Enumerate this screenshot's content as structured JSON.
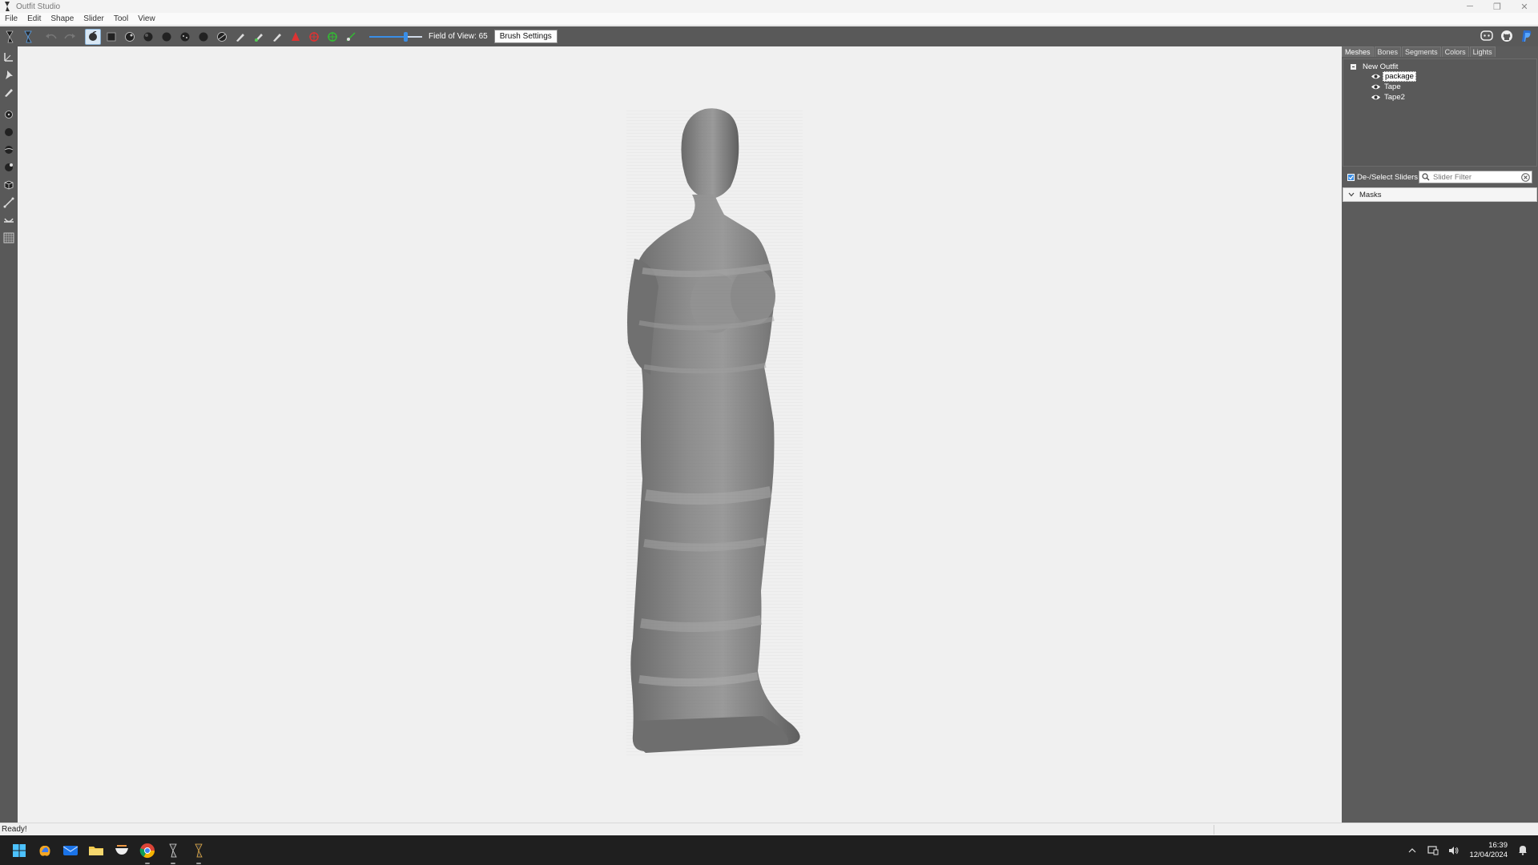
{
  "window": {
    "title": "Outfit Studio",
    "controls": {
      "minimize": "─",
      "restore": "❐",
      "close": "✕"
    }
  },
  "menu": {
    "items": [
      "File",
      "Edit",
      "Shape",
      "Slider",
      "Tool",
      "View"
    ]
  },
  "toolbar": {
    "fov_label": "Field of View: 65",
    "fov_value": 65,
    "brush_settings_label": "Brush Settings"
  },
  "panel": {
    "tabs": [
      "Meshes",
      "Bones",
      "Segments",
      "Colors",
      "Lights"
    ],
    "active_tab": "Meshes",
    "tree": {
      "root": "New Outfit",
      "children": [
        {
          "label": "package",
          "selected": true
        },
        {
          "label": "Tape",
          "selected": false
        },
        {
          "label": "Tape2",
          "selected": false
        }
      ]
    },
    "deselect_sliders_label": "De-/Select Sliders",
    "slider_filter_placeholder": "Slider Filter",
    "masks_label": "Masks"
  },
  "status": {
    "text": "Ready!"
  },
  "taskbar": {
    "time": "16:39",
    "date": "12/04/2024"
  },
  "colors": {
    "accent": "#3a8ee6",
    "toolbar_bg": "#595959",
    "viewport_bg": "#f0f0f0",
    "model": "#8a8a8a"
  }
}
